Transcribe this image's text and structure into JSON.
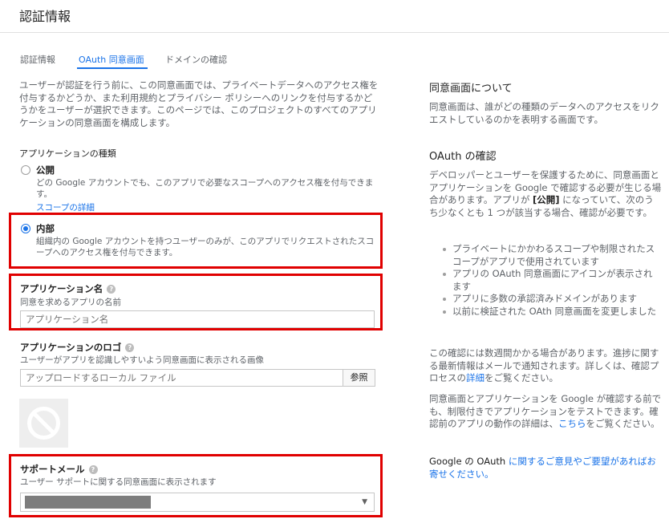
{
  "header": {
    "title": "認証情報"
  },
  "tabs": [
    {
      "label": "認証情報"
    },
    {
      "label": "OAuth 同意画面"
    },
    {
      "label": "ドメインの確認"
    }
  ],
  "intro": "ユーザーが認証を行う前に、この同意画面では、プライベートデータへのアクセス権を付与するかどうか、また利用規約とプライバシー ポリシーへのリンクを付与するかどうかをユーザーが選択できます。このページでは、このプロジェクトのすべてのアプリケーションの同意画面を構成します。",
  "app_type": {
    "heading": "アプリケーションの種類",
    "public": {
      "title": "公開",
      "desc": "どの Google アカウントでも、このアプリで必要なスコープへのアクセス権を付与できます。",
      "link": "スコープの詳細",
      "selected": false
    },
    "internal": {
      "title": "内部",
      "desc": "組織内の Google アカウントを持つユーザーのみが、このアプリでリクエストされたスコープへのアクセス権を付与できます。",
      "selected": true
    }
  },
  "app_name": {
    "label": "アプリケーション名",
    "help": "同意を求めるアプリの名前",
    "placeholder": "アプリケーション名"
  },
  "app_logo": {
    "label": "アプリケーションのロゴ",
    "help": "ユーザーがアプリを認識しやすいよう同意画面に表示される画像",
    "placeholder": "アップロードするローカル ファイル",
    "browse": "参照"
  },
  "support_email": {
    "label": "サポートメール",
    "help": "ユーザー サポートに関する同意画面に表示されます"
  },
  "sidebar": {
    "about_title": "同意画面について",
    "about_text": "同意画面は、誰がどの種類のデータへのアクセスをリクエストしているのかを表明する画面です。",
    "verify_title": "OAuth の確認",
    "verify_text_1": "デベロッパーとユーザーを保護するために、同意画面とアプリケーションを Google で確認する必要が生じる場合があります。アプリが ",
    "verify_text_bold": "[公開]",
    "verify_text_2": " になっていて、次のうち少なくとも 1 つが該当する場合、確認が必要です。",
    "bullets": [
      "プライベートにかかわるスコープや制限されたスコープがアプリで使用されています",
      "アプリの OAuth 同意画面にアイコンが表示されます",
      "アプリに多数の承認済みドメインがあります",
      "以前に検証された OAth 同意画面を変更しました"
    ],
    "p1_a": "この確認には数週間かかる場合があります。進捗に関する最新情報はメールで通知されます。詳しくは、確認プロセスの",
    "p1_link": "詳細",
    "p1_b": "をご覧ください。",
    "p2_a": "同意画面とアプリケーションを Google が確認する前でも、制限付きでアプリケーションをテストできます。確認前のアプリの動作の詳細は、",
    "p2_link": "こちら",
    "p2_b": "をご覧ください。",
    "feedback_a": "Google の OAuth ",
    "feedback_link": "に関するご意見やご要望があればお寄せください。"
  },
  "colors": {
    "accent": "#1a73e8",
    "highlight_border": "#e00000"
  }
}
